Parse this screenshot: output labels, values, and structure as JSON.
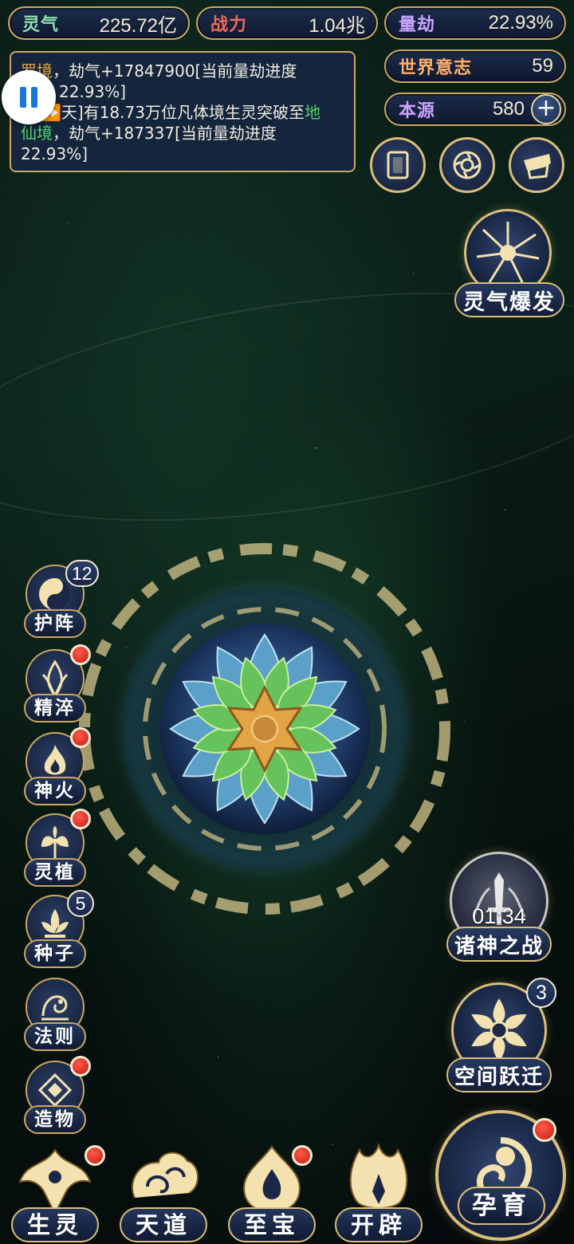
{
  "resources": [
    {
      "label": "灵气",
      "value": "225.72亿",
      "label_color": "#8ee0b0"
    },
    {
      "label": "战力",
      "value": "1.04兆",
      "label_color": "#ef6a5a"
    },
    {
      "label": "量劫",
      "value": "22.93%",
      "label_color": "#c9a3ff"
    },
    {
      "label": "世界意志",
      "value": "59",
      "label_color": "#ffb06a"
    },
    {
      "label": "本源",
      "value": "580",
      "label_color": "#c9a3ff"
    }
  ],
  "log": {
    "line1_place": "罗境",
    "line1_text": "，劫气+17847900[当前量劫进度",
    "line2_text": "22.93%]",
    "line3_prefix": "天]有18.73万位凡体境生灵突破至",
    "line3_realm_a": "地",
    "line4_realm_b": "仙境",
    "line4_text": "，劫气+187337[当前量劫进度",
    "line5_text": "22.93%]"
  },
  "actions": {
    "aura_burst": "灵气爆发",
    "gods_war": "诸神之战",
    "gods_war_timer": "01:34",
    "space_jump": "空间跃迁",
    "space_jump_count": "3"
  },
  "side_menu": [
    {
      "label": "护阵",
      "badge": "12",
      "dot": false
    },
    {
      "label": "精淬",
      "badge": "",
      "dot": true
    },
    {
      "label": "神火",
      "badge": "",
      "dot": true
    },
    {
      "label": "灵植",
      "badge": "",
      "dot": true
    },
    {
      "label": "种子",
      "badge": "5",
      "dot": false
    },
    {
      "label": "法则",
      "badge": "",
      "dot": false
    },
    {
      "label": "造物",
      "badge": "",
      "dot": true
    }
  ],
  "bottom_nav": [
    {
      "label": "生灵",
      "dot": true
    },
    {
      "label": "天道",
      "dot": false
    },
    {
      "label": "至宝",
      "dot": true
    },
    {
      "label": "开辟",
      "dot": false
    }
  ],
  "nurture": {
    "label": "孕育",
    "dot": true
  },
  "colors": {
    "gold": "#d9be7a",
    "panel": "#1c2c4a",
    "red_dot": "#d8271b"
  }
}
